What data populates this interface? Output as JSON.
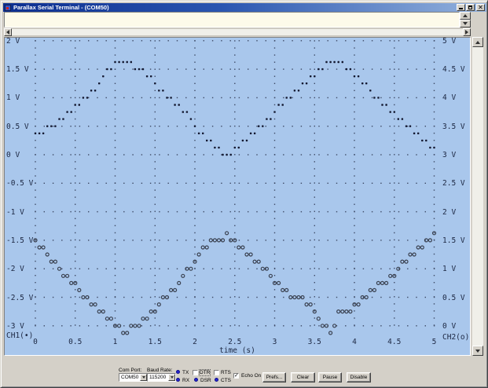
{
  "window": {
    "title": "Parallax Serial Terminal - (COM50)"
  },
  "terminal_text": "",
  "chart_data": {
    "type": "scatter",
    "title": "",
    "xlabel": "time (s)",
    "x_ticks": [
      "0",
      "0.5",
      "1",
      "1.5",
      "2",
      "2.5",
      "3",
      "3.5",
      "4",
      "4.5",
      "5"
    ],
    "x_tick_values": [
      0,
      0.5,
      1,
      1.5,
      2,
      2.5,
      3,
      3.5,
      4,
      4.5,
      5
    ],
    "grid": true,
    "left_axis": {
      "channel_label": "CH1(•)",
      "ticks": [
        "2 V",
        "1.5 V",
        "1 V",
        "0.5 V",
        "0 V",
        "-0.5 V",
        "-1 V",
        "-1.5 V",
        "-2 V",
        "-2.5 V",
        "-3 V"
      ],
      "tick_values": [
        2,
        1.5,
        1,
        0.5,
        0,
        -0.5,
        -1,
        -1.5,
        -2,
        -2.5,
        -3
      ],
      "range": [
        -3,
        2
      ]
    },
    "right_axis": {
      "channel_label": "CH2(o)",
      "ticks": [
        "5 V",
        "4.5 V",
        "4 V",
        "3.5 V",
        "3 V",
        "2.5 V",
        "2 V",
        "1.5 V",
        "1 V",
        "0.5 V",
        "0 V"
      ],
      "tick_values": [
        5,
        4.5,
        4,
        3.5,
        3,
        2.5,
        2,
        1.5,
        1,
        0.5,
        0
      ],
      "range": [
        0,
        5
      ]
    },
    "series": [
      {
        "name": "CH1",
        "marker": "dot",
        "axis": "left",
        "t_start": 0,
        "t_step": 0.1,
        "values": [
          0.33,
          0.4,
          0.48,
          0.58,
          0.7,
          0.83,
          0.97,
          1.1,
          1.25,
          1.45,
          1.63,
          1.66,
          1.62,
          1.5,
          1.38,
          1.25,
          1.12,
          0.99,
          0.86,
          0.73,
          0.48,
          0.34,
          0.21,
          0.08,
          -0.04,
          0.08,
          0.21,
          0.34,
          0.48,
          0.62,
          0.75,
          0.92,
          1.05,
          1.16,
          1.28,
          1.42,
          1.55,
          1.66,
          1.66,
          1.53,
          1.4,
          1.26,
          1.13,
          0.99,
          0.86,
          0.73,
          0.6,
          0.46,
          0.33,
          0.2,
          0.1
        ]
      },
      {
        "name": "CH2",
        "marker": "circle",
        "axis": "right",
        "t_start": 0,
        "t_step": 0.1,
        "values": [
          1.5,
          1.33,
          1.17,
          1.0,
          0.84,
          0.7,
          0.55,
          0.41,
          0.3,
          0.17,
          0.05,
          -0.1,
          -0.05,
          0.06,
          0.18,
          0.31,
          0.44,
          0.57,
          0.7,
          0.95,
          1.07,
          1.32,
          1.44,
          1.44,
          1.57,
          1.44,
          1.32,
          1.2,
          1.07,
          1.0,
          0.8,
          0.67,
          0.55,
          0.48,
          0.42,
          0.22,
          0.05,
          -0.1,
          0.22,
          0.25,
          0.37,
          0.5,
          0.6,
          0.73,
          0.8,
          0.87,
          1.1,
          1.24,
          1.37,
          1.5,
          1.62
        ]
      }
    ]
  },
  "toolbar": {
    "com_port_label": "Com Port:",
    "com_port_value": "COM50",
    "baud_rate_label": "Baud Rate:",
    "baud_rate_value": "115200",
    "tx_label": "TX",
    "rx_label": "RX",
    "dtr_label": "DTR",
    "dsr_label": "DSR",
    "rts_label": "RTS",
    "cts_label": "CTS",
    "dtr_checked": false,
    "rts_checked": false,
    "echo_label": "Echo On",
    "echo_checked": true,
    "check_glyph": "✓",
    "buttons": [
      "Prefs...",
      "Clear",
      "Pause",
      "Disable"
    ]
  },
  "colors": {
    "plot_bg": "#a9c7ec",
    "dot": "#131830",
    "circle": "#39404f",
    "grid": "#3d4964",
    "led": "#2323d0",
    "titlebar_left": "#0c2e8f",
    "titlebar_right": "#93b2dd",
    "text_area_bg": "#fdfaea",
    "chrome_gray": "#d4d0c8"
  }
}
